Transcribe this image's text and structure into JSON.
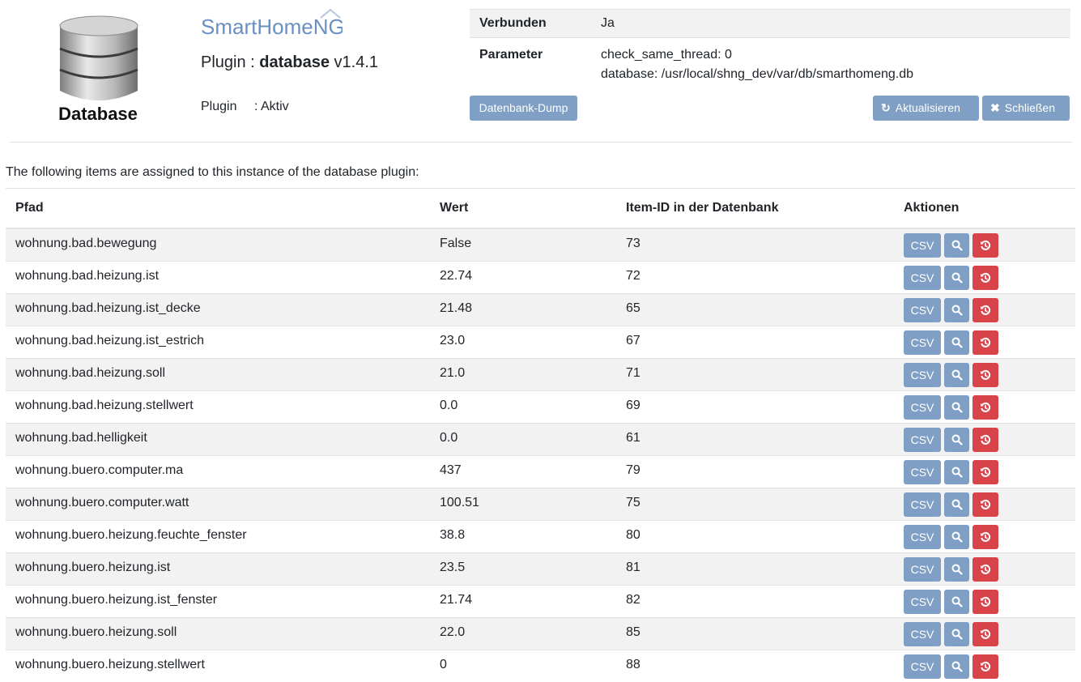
{
  "header": {
    "logo_label": "Database",
    "brand": "SmartHomeNG",
    "plugin_prefix": "Plugin : ",
    "plugin_name": "database",
    "plugin_version": "v1.4.1",
    "status_label": "Plugin",
    "status_value": ": Aktiv"
  },
  "info": {
    "connected_label": "Verbunden",
    "connected_value": "Ja",
    "params_label": "Parameter",
    "param1": "check_same_thread: 0",
    "param2": "database: /usr/local/shng_dev/var/db/smarthomeng.db"
  },
  "buttons": {
    "dump": "Datenbank-Dump",
    "refresh": "Aktualisieren",
    "close": "Schließen"
  },
  "intro": "The following items are assigned to this instance of the database plugin:",
  "table": {
    "headers": [
      "Pfad",
      "Wert",
      "Item-ID in der Datenbank",
      "Aktionen"
    ],
    "csv_label": "CSV",
    "rows": [
      {
        "path": "wohnung.bad.bewegung",
        "value": "False",
        "id": "73"
      },
      {
        "path": "wohnung.bad.heizung.ist",
        "value": "22.74",
        "id": "72"
      },
      {
        "path": "wohnung.bad.heizung.ist_decke",
        "value": "21.48",
        "id": "65"
      },
      {
        "path": "wohnung.bad.heizung.ist_estrich",
        "value": "23.0",
        "id": "67"
      },
      {
        "path": "wohnung.bad.heizung.soll",
        "value": "21.0",
        "id": "71"
      },
      {
        "path": "wohnung.bad.heizung.stellwert",
        "value": "0.0",
        "id": "69"
      },
      {
        "path": "wohnung.bad.helligkeit",
        "value": "0.0",
        "id": "61"
      },
      {
        "path": "wohnung.buero.computer.ma",
        "value": "437",
        "id": "79"
      },
      {
        "path": "wohnung.buero.computer.watt",
        "value": "100.51",
        "id": "75"
      },
      {
        "path": "wohnung.buero.heizung.feuchte_fenster",
        "value": "38.8",
        "id": "80"
      },
      {
        "path": "wohnung.buero.heizung.ist",
        "value": "23.5",
        "id": "81"
      },
      {
        "path": "wohnung.buero.heizung.ist_fenster",
        "value": "21.74",
        "id": "82"
      },
      {
        "path": "wohnung.buero.heizung.soll",
        "value": "22.0",
        "id": "85"
      },
      {
        "path": "wohnung.buero.heizung.stellwert",
        "value": "0",
        "id": "88"
      }
    ]
  },
  "colors": {
    "button_blue": "#7f9fc4",
    "button_red": "#d9434a",
    "brand_blue": "#6a8fc3"
  },
  "icons": {
    "refresh": "refresh-icon",
    "close": "close-icon",
    "view": "search-icon",
    "reset": "history-icon"
  }
}
